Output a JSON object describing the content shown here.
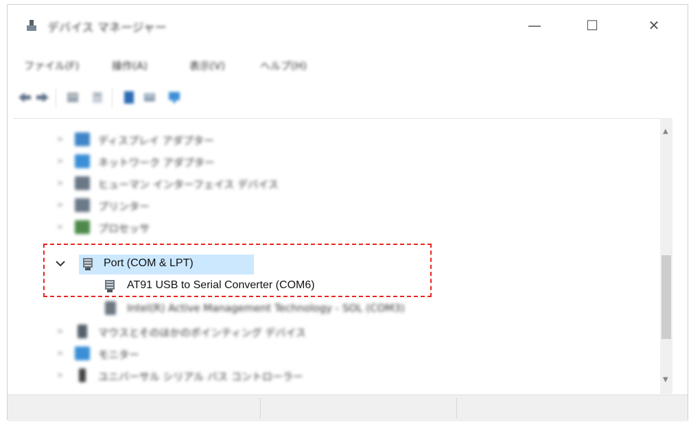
{
  "window": {
    "title": "デバイス マネージャー",
    "minimize_glyph": "—",
    "maximize_glyph": "☐",
    "close_glyph": "✕"
  },
  "menu": [
    "ファイル(F)",
    "操作(A)",
    "表示(V)",
    "ヘルプ(H)"
  ],
  "toolbar": {
    "icons": [
      "back-arrow-icon",
      "forward-arrow-icon",
      "grid-view-icon",
      "properties-icon",
      "help-icon",
      "device-list-icon",
      "monitor-icon"
    ]
  },
  "tree": {
    "items_before": [
      {
        "label": "ディスプレイ アダプター",
        "icon": "display-adapter-icon",
        "color": "#3f86c8"
      },
      {
        "label": "ネットワーク アダプター",
        "icon": "network-adapter-icon",
        "color": "#3a8fd6"
      },
      {
        "label": "ヒューマン インターフェイス デバイス",
        "icon": "hid-icon",
        "color": "#6a7886"
      },
      {
        "label": "プリンター",
        "icon": "printer-icon",
        "color": "#6b7a88"
      },
      {
        "label": "プロセッサ",
        "icon": "processor-icon",
        "color": "#4d8a4a"
      }
    ],
    "port": {
      "label": "Port  (COM & LPT)",
      "children": [
        {
          "label": "AT91 USB to Serial Converter (COM6)"
        },
        {
          "label": "Intel(R) Active Management Technology - SOL (COM3)"
        }
      ]
    },
    "items_after": [
      {
        "label": "マウスとそのほかのポインティング デバイス",
        "icon": "mouse-icon",
        "color": "#55606a"
      },
      {
        "label": "モニター",
        "icon": "monitor-icon",
        "color": "#3a8fd6"
      },
      {
        "label": "ユニバーサル シリアル バス コントローラー",
        "icon": "usb-icon",
        "color": "#444"
      }
    ]
  },
  "colors": {
    "selection": "#cce8ff",
    "highlight_box": "#e8231f"
  }
}
